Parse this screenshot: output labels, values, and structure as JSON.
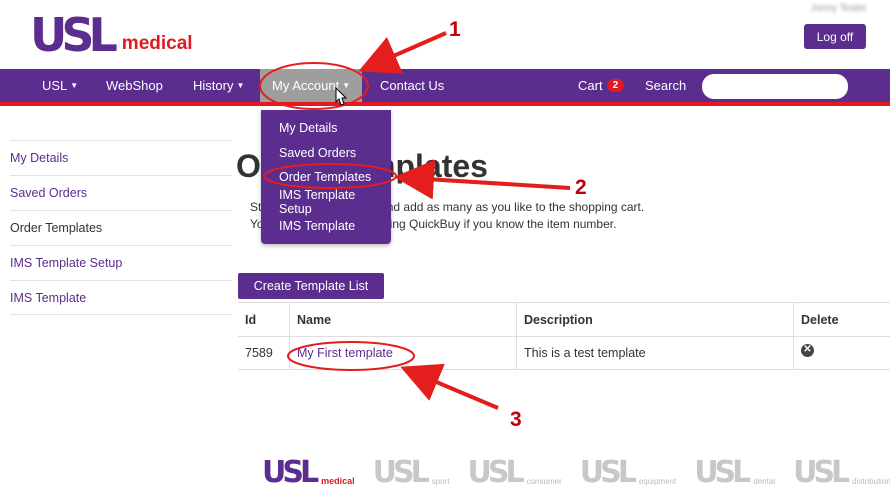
{
  "header": {
    "logo_mark": "USL",
    "logo_word": "medical",
    "user_name": "Jonny Tester",
    "logoff_label": "Log off"
  },
  "navbar": {
    "items": [
      {
        "label": "USL",
        "has_caret": true
      },
      {
        "label": "WebShop",
        "has_caret": false
      },
      {
        "label": "History",
        "has_caret": true
      },
      {
        "label": "My Account",
        "has_caret": true
      },
      {
        "label": "Contact Us",
        "has_caret": false
      }
    ],
    "cart_label": "Cart",
    "cart_count": "2",
    "search_label": "Search",
    "search_placeholder": ""
  },
  "account_dropdown": {
    "items": [
      "My Details",
      "Saved Orders",
      "Order Templates",
      "IMS Template Setup",
      "IMS Template"
    ]
  },
  "sidebar": {
    "items": [
      "My Details",
      "Saved Orders",
      "Order Templates",
      "IMS Template Setup",
      "IMS Template"
    ],
    "current": "Order Templates"
  },
  "main": {
    "title": "Order Templates",
    "intro_line1": "Start creating templates and add as many as you like to the shopping cart.",
    "intro_line2": "You can also add items using QuickBuy if you know the item number.",
    "create_button": "Create Template List",
    "table": {
      "columns": [
        "Id",
        "Name",
        "Description",
        "Delete"
      ],
      "rows": [
        {
          "id": "7589",
          "name": "My First template",
          "description": "This is a test template"
        }
      ]
    }
  },
  "footer": {
    "brands": [
      {
        "mark": "USL",
        "word": "medical"
      },
      {
        "mark": "USL",
        "word": "sport"
      },
      {
        "mark": "USL",
        "word": "consumer"
      },
      {
        "mark": "USL",
        "word": "equipment"
      },
      {
        "mark": "USL",
        "word": "dental"
      },
      {
        "mark": "USL",
        "word": "distribution"
      }
    ]
  },
  "annotations": {
    "step1": "1",
    "step2": "2",
    "step3": "3",
    "color": "#e41d1d"
  },
  "colors": {
    "brand_purple": "#5b2d8e",
    "brand_red": "#e01a22",
    "active_tab_gray": "#9e9e9e"
  }
}
